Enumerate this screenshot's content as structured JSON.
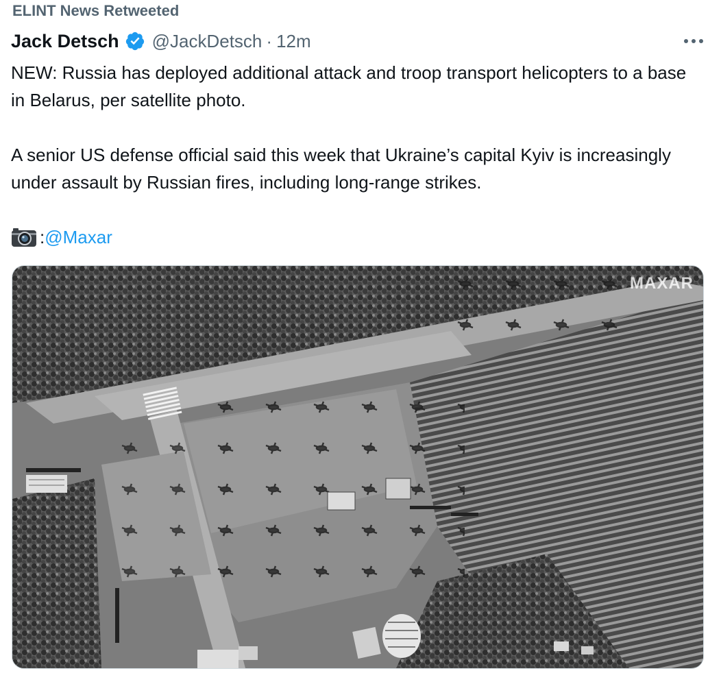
{
  "retweet": {
    "label": "ELINT News Retweeted"
  },
  "author": {
    "name": "Jack Detsch",
    "handle": "@JackDetsch",
    "separator": "·",
    "time": "12m"
  },
  "tweet": {
    "paragraph1": "NEW: Russia has deployed additional attack and troop transport helicopters to a base in Belarus, per satellite photo.",
    "paragraph2": "A senior US defense official said this week that Ukraine’s capital Kyiv is increasingly under assault by Russian fires, including long-range strikes.",
    "credit_prefix": ":",
    "credit_link": "@Maxar"
  },
  "media": {
    "watermark": "MAXAR"
  },
  "icons": {
    "verified": "verified-badge-icon",
    "more": "more-options-icon",
    "camera": "camera-icon"
  },
  "colors": {
    "link": "#1d9bf0",
    "secondary": "#536471",
    "verified": "#1d9bf0"
  }
}
